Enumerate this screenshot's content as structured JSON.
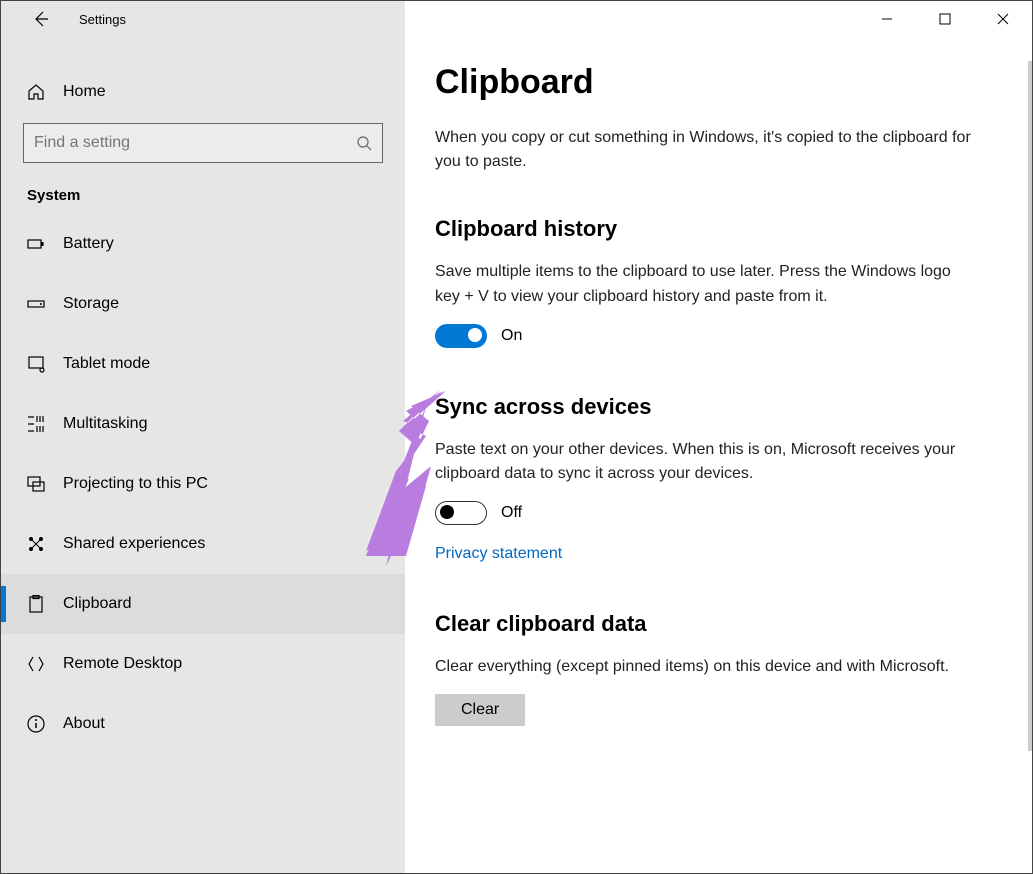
{
  "window": {
    "title": "Settings"
  },
  "home_label": "Home",
  "search_placeholder": "Find a setting",
  "section_label": "System",
  "nav": [
    {
      "id": "battery",
      "label": "Battery",
      "icon": "battery-icon",
      "selected": false
    },
    {
      "id": "storage",
      "label": "Storage",
      "icon": "storage-icon",
      "selected": false
    },
    {
      "id": "tablet",
      "label": "Tablet mode",
      "icon": "tablet-icon",
      "selected": false
    },
    {
      "id": "multitasking",
      "label": "Multitasking",
      "icon": "multitasking-icon",
      "selected": false
    },
    {
      "id": "projecting",
      "label": "Projecting to this PC",
      "icon": "projecting-icon",
      "selected": false
    },
    {
      "id": "shared",
      "label": "Shared experiences",
      "icon": "shared-icon",
      "selected": false
    },
    {
      "id": "clipboard",
      "label": "Clipboard",
      "icon": "clipboard-icon",
      "selected": true
    },
    {
      "id": "remote",
      "label": "Remote Desktop",
      "icon": "remote-icon",
      "selected": false
    },
    {
      "id": "about",
      "label": "About",
      "icon": "about-icon",
      "selected": false
    }
  ],
  "page": {
    "title": "Clipboard",
    "desc": "When you copy or cut something in Windows, it's copied to the clipboard for you to paste.",
    "history": {
      "title": "Clipboard history",
      "desc": "Save multiple items to the clipboard to use later. Press the Windows logo key + V to view your clipboard history and paste from it.",
      "toggle_state": "On",
      "toggle_on": true
    },
    "sync": {
      "title": "Sync across devices",
      "desc": "Paste text on your other devices. When this is on, Microsoft receives your clipboard data to sync it across your devices.",
      "toggle_state": "Off",
      "toggle_on": false,
      "link": "Privacy statement"
    },
    "clear": {
      "title": "Clear clipboard data",
      "desc": "Clear everything (except pinned items) on this device and with Microsoft.",
      "button": "Clear"
    }
  },
  "annotation_arrow_color": "#b97de0"
}
